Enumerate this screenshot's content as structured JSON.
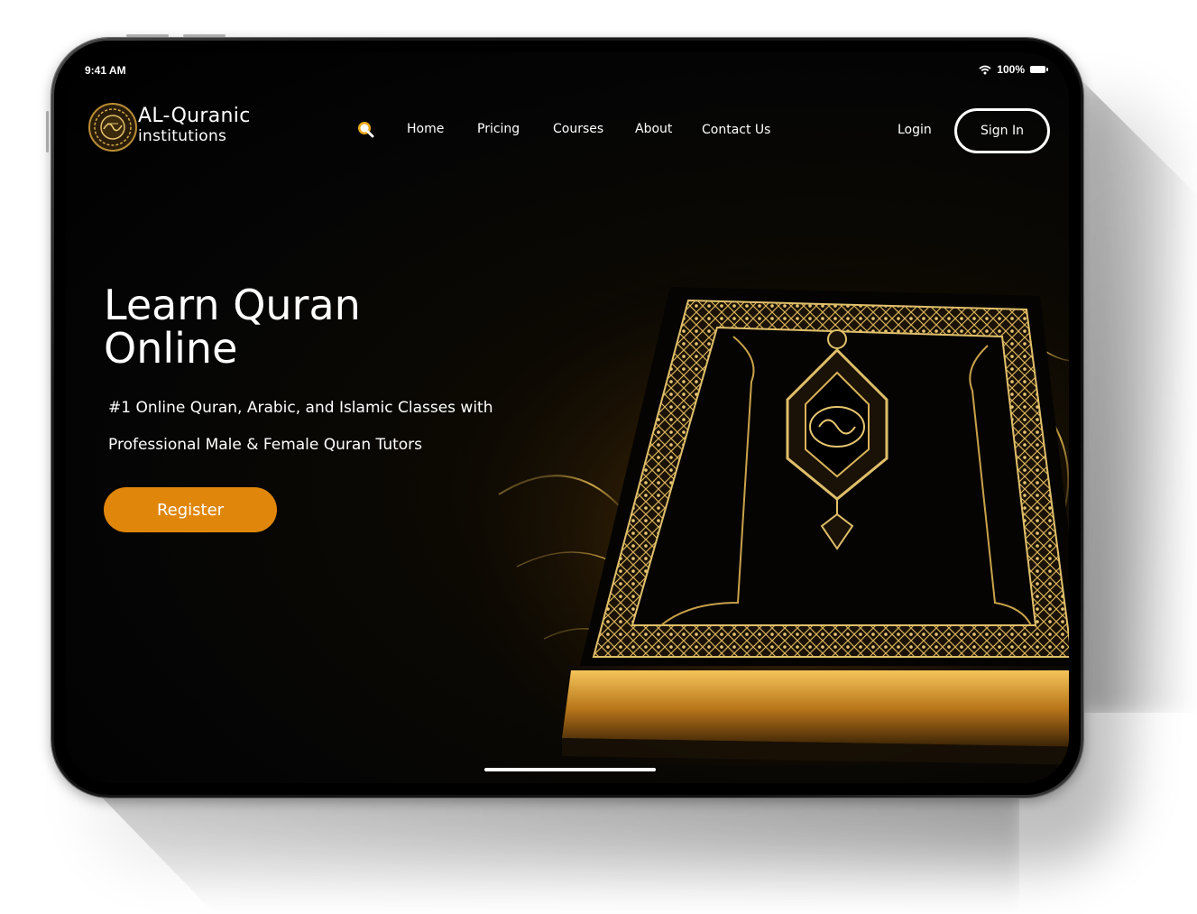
{
  "status_bar": {
    "time": "9:41 AM",
    "battery": "100%",
    "icons": [
      "wifi-icon",
      "battery-icon"
    ]
  },
  "brand": {
    "name": "AL-Quranic",
    "subtitle": "institutions"
  },
  "nav": {
    "items": [
      {
        "label": "Home"
      },
      {
        "label": "Pricing"
      },
      {
        "label": "Courses"
      },
      {
        "label": "About"
      },
      {
        "label": "Contact Us"
      }
    ],
    "login_label": "Login",
    "signin_label": "Sign In"
  },
  "hero": {
    "title_line1": "Learn Quran",
    "title_line2": "Online",
    "subtitle_line1": "#1 Online Quran, Arabic, and Islamic Classes with",
    "subtitle_line2": "Professional Male & Female Quran Tutors",
    "register_label": "Register"
  },
  "colors": {
    "accent": "#e0860b",
    "gold": "#c9a24a",
    "background": "#050505"
  }
}
